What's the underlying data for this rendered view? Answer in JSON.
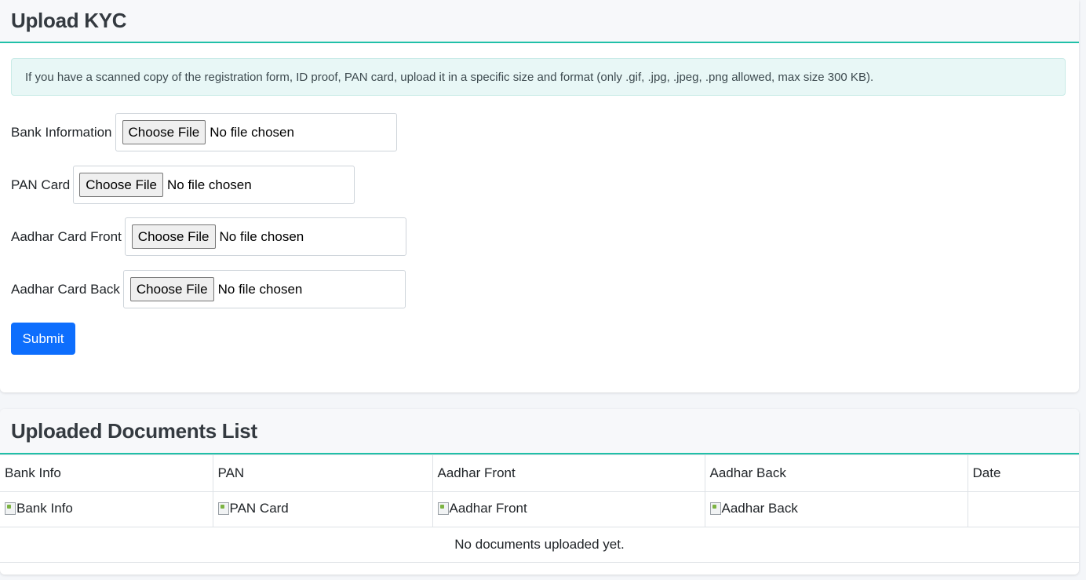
{
  "upload_card": {
    "title": "Upload KYC",
    "notice": "If you have a scanned copy of the registration form, ID proof, PAN card, upload it in a specific size and format (only .gif, .jpg, .jpeg, .png allowed, max size 300 KB).",
    "fields": [
      {
        "label": "Bank Information",
        "button": "Choose File",
        "status": "No file chosen"
      },
      {
        "label": "PAN Card",
        "button": "Choose File",
        "status": "No file chosen"
      },
      {
        "label": "Aadhar Card Front",
        "button": "Choose File",
        "status": "No file chosen"
      },
      {
        "label": "Aadhar Card Back",
        "button": "Choose File",
        "status": "No file chosen"
      }
    ],
    "submit_label": "Submit"
  },
  "documents_card": {
    "title": "Uploaded Documents List",
    "columns": [
      "Bank Info",
      "PAN",
      "Aadhar Front",
      "Aadhar Back",
      "Date"
    ],
    "image_alts": [
      "Bank Info",
      "PAN Card",
      "Aadhar Front",
      "Aadhar Back",
      ""
    ],
    "empty_message": "No documents uploaded yet."
  },
  "colors": {
    "accent_border": "#20c0a8",
    "primary_button": "#0d6efd",
    "alert_background": "#e8f7f6"
  }
}
